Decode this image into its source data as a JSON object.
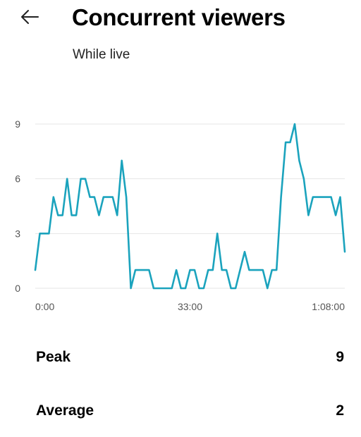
{
  "header": {
    "title": "Concurrent viewers",
    "subtitle": "While live",
    "back_icon": "arrow-left-icon"
  },
  "stats": [
    {
      "label": "Peak",
      "value": "9"
    },
    {
      "label": "Average",
      "value": "2"
    }
  ],
  "chart_data": {
    "type": "line",
    "title": "Concurrent viewers",
    "xlabel": "",
    "ylabel": "",
    "x_ticks": [
      "0:00",
      "33:00",
      "1:08:00"
    ],
    "y_ticks": [
      0,
      3,
      6,
      9
    ],
    "ylim": [
      0,
      9
    ],
    "grid": true,
    "color": "#1ba3bd",
    "series": [
      {
        "values": [
          1,
          3,
          3,
          3,
          5,
          4,
          4,
          6,
          4,
          4,
          6,
          6,
          5,
          5,
          4,
          5,
          5,
          5,
          4,
          7,
          5,
          0,
          1,
          1,
          1,
          1,
          0,
          0,
          0,
          0,
          0,
          1,
          0,
          0,
          1,
          1,
          0,
          0,
          1,
          1,
          3,
          1,
          1,
          0,
          0,
          1,
          2,
          1,
          1,
          1,
          1,
          0,
          1,
          1,
          5,
          8,
          8,
          9,
          7,
          6,
          4,
          5,
          5,
          5,
          5,
          5,
          4,
          5,
          2
        ]
      }
    ]
  }
}
